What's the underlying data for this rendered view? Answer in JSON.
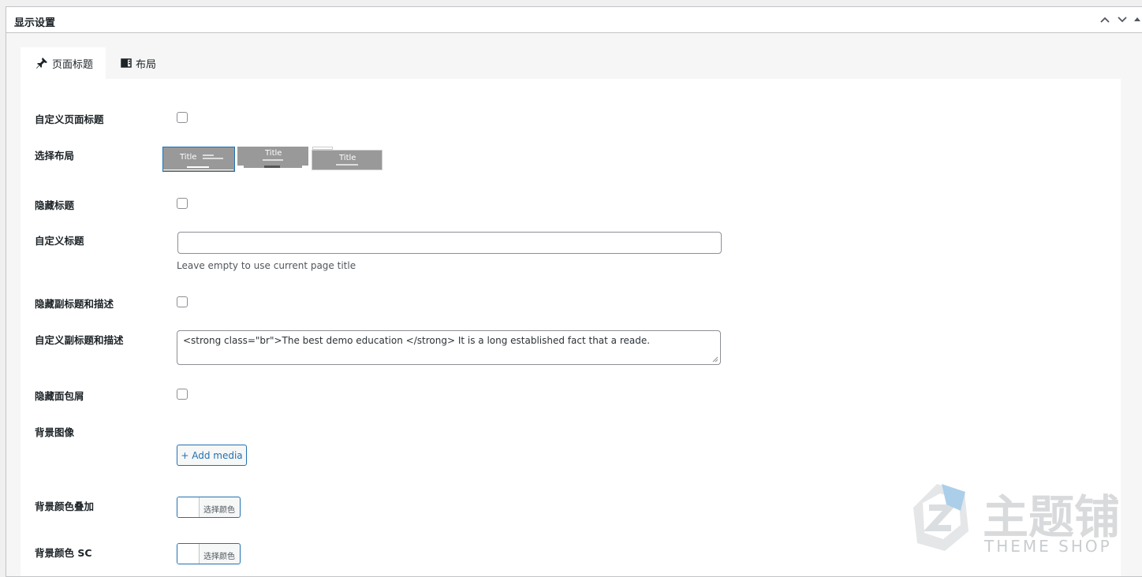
{
  "metabox": {
    "title": "显示设置",
    "controls": [
      "chevron-up-icon",
      "chevron-down-icon",
      "triangle-up-icon"
    ]
  },
  "tabs": [
    {
      "label": "页面标题",
      "icon": "pin-icon",
      "active": true
    },
    {
      "label": "布局",
      "icon": "layout-icon",
      "active": false
    }
  ],
  "fields": {
    "custom_page_title": {
      "label": "自定义页面标题",
      "checked": false
    },
    "layout": {
      "label": "选择布局",
      "options": [
        {
          "title": "Title",
          "selected": true
        },
        {
          "title": "Title",
          "selected": false
        },
        {
          "title": "Title",
          "selected": false
        }
      ]
    },
    "hide_title": {
      "label": "隐藏标题",
      "checked": false
    },
    "custom_title": {
      "label": "自定义标题",
      "value": "",
      "hint": "Leave empty to use current page title"
    },
    "hide_subtitle": {
      "label": "隐藏副标题和描述",
      "checked": false
    },
    "custom_subtitle": {
      "label": "自定义副标题和描述",
      "value": "<strong class=\"br\">The best demo education </strong> It is a long established fact that a reade."
    },
    "hide_breadcrumb": {
      "label": "隐藏面包屑",
      "checked": false
    },
    "bg_image": {
      "label": "背景图像",
      "button": "+ Add media"
    },
    "bg_overlay": {
      "label": "背景颜色叠加",
      "button": "选择颜色"
    },
    "bg_color_sc": {
      "label": "背景颜色 SC",
      "button": "选择颜色"
    }
  },
  "watermark": {
    "brand": "主题铺",
    "tagline": "THEME SHOP"
  }
}
